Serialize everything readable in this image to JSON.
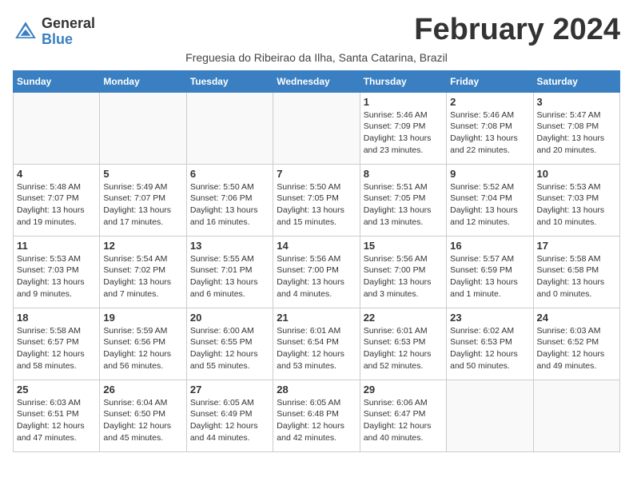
{
  "logo": {
    "general": "General",
    "blue": "Blue"
  },
  "title": "February 2024",
  "subtitle": "Freguesia do Ribeirao da Ilha, Santa Catarina, Brazil",
  "days_of_week": [
    "Sunday",
    "Monday",
    "Tuesday",
    "Wednesday",
    "Thursday",
    "Friday",
    "Saturday"
  ],
  "weeks": [
    [
      {
        "day": "",
        "info": ""
      },
      {
        "day": "",
        "info": ""
      },
      {
        "day": "",
        "info": ""
      },
      {
        "day": "",
        "info": ""
      },
      {
        "day": "1",
        "info": "Sunrise: 5:46 AM\nSunset: 7:09 PM\nDaylight: 13 hours\nand 23 minutes."
      },
      {
        "day": "2",
        "info": "Sunrise: 5:46 AM\nSunset: 7:08 PM\nDaylight: 13 hours\nand 22 minutes."
      },
      {
        "day": "3",
        "info": "Sunrise: 5:47 AM\nSunset: 7:08 PM\nDaylight: 13 hours\nand 20 minutes."
      }
    ],
    [
      {
        "day": "4",
        "info": "Sunrise: 5:48 AM\nSunset: 7:07 PM\nDaylight: 13 hours\nand 19 minutes."
      },
      {
        "day": "5",
        "info": "Sunrise: 5:49 AM\nSunset: 7:07 PM\nDaylight: 13 hours\nand 17 minutes."
      },
      {
        "day": "6",
        "info": "Sunrise: 5:50 AM\nSunset: 7:06 PM\nDaylight: 13 hours\nand 16 minutes."
      },
      {
        "day": "7",
        "info": "Sunrise: 5:50 AM\nSunset: 7:05 PM\nDaylight: 13 hours\nand 15 minutes."
      },
      {
        "day": "8",
        "info": "Sunrise: 5:51 AM\nSunset: 7:05 PM\nDaylight: 13 hours\nand 13 minutes."
      },
      {
        "day": "9",
        "info": "Sunrise: 5:52 AM\nSunset: 7:04 PM\nDaylight: 13 hours\nand 12 minutes."
      },
      {
        "day": "10",
        "info": "Sunrise: 5:53 AM\nSunset: 7:03 PM\nDaylight: 13 hours\nand 10 minutes."
      }
    ],
    [
      {
        "day": "11",
        "info": "Sunrise: 5:53 AM\nSunset: 7:03 PM\nDaylight: 13 hours\nand 9 minutes."
      },
      {
        "day": "12",
        "info": "Sunrise: 5:54 AM\nSunset: 7:02 PM\nDaylight: 13 hours\nand 7 minutes."
      },
      {
        "day": "13",
        "info": "Sunrise: 5:55 AM\nSunset: 7:01 PM\nDaylight: 13 hours\nand 6 minutes."
      },
      {
        "day": "14",
        "info": "Sunrise: 5:56 AM\nSunset: 7:00 PM\nDaylight: 13 hours\nand 4 minutes."
      },
      {
        "day": "15",
        "info": "Sunrise: 5:56 AM\nSunset: 7:00 PM\nDaylight: 13 hours\nand 3 minutes."
      },
      {
        "day": "16",
        "info": "Sunrise: 5:57 AM\nSunset: 6:59 PM\nDaylight: 13 hours\nand 1 minute."
      },
      {
        "day": "17",
        "info": "Sunrise: 5:58 AM\nSunset: 6:58 PM\nDaylight: 13 hours\nand 0 minutes."
      }
    ],
    [
      {
        "day": "18",
        "info": "Sunrise: 5:58 AM\nSunset: 6:57 PM\nDaylight: 12 hours\nand 58 minutes."
      },
      {
        "day": "19",
        "info": "Sunrise: 5:59 AM\nSunset: 6:56 PM\nDaylight: 12 hours\nand 56 minutes."
      },
      {
        "day": "20",
        "info": "Sunrise: 6:00 AM\nSunset: 6:55 PM\nDaylight: 12 hours\nand 55 minutes."
      },
      {
        "day": "21",
        "info": "Sunrise: 6:01 AM\nSunset: 6:54 PM\nDaylight: 12 hours\nand 53 minutes."
      },
      {
        "day": "22",
        "info": "Sunrise: 6:01 AM\nSunset: 6:53 PM\nDaylight: 12 hours\nand 52 minutes."
      },
      {
        "day": "23",
        "info": "Sunrise: 6:02 AM\nSunset: 6:53 PM\nDaylight: 12 hours\nand 50 minutes."
      },
      {
        "day": "24",
        "info": "Sunrise: 6:03 AM\nSunset: 6:52 PM\nDaylight: 12 hours\nand 49 minutes."
      }
    ],
    [
      {
        "day": "25",
        "info": "Sunrise: 6:03 AM\nSunset: 6:51 PM\nDaylight: 12 hours\nand 47 minutes."
      },
      {
        "day": "26",
        "info": "Sunrise: 6:04 AM\nSunset: 6:50 PM\nDaylight: 12 hours\nand 45 minutes."
      },
      {
        "day": "27",
        "info": "Sunrise: 6:05 AM\nSunset: 6:49 PM\nDaylight: 12 hours\nand 44 minutes."
      },
      {
        "day": "28",
        "info": "Sunrise: 6:05 AM\nSunset: 6:48 PM\nDaylight: 12 hours\nand 42 minutes."
      },
      {
        "day": "29",
        "info": "Sunrise: 6:06 AM\nSunset: 6:47 PM\nDaylight: 12 hours\nand 40 minutes."
      },
      {
        "day": "",
        "info": ""
      },
      {
        "day": "",
        "info": ""
      }
    ]
  ]
}
